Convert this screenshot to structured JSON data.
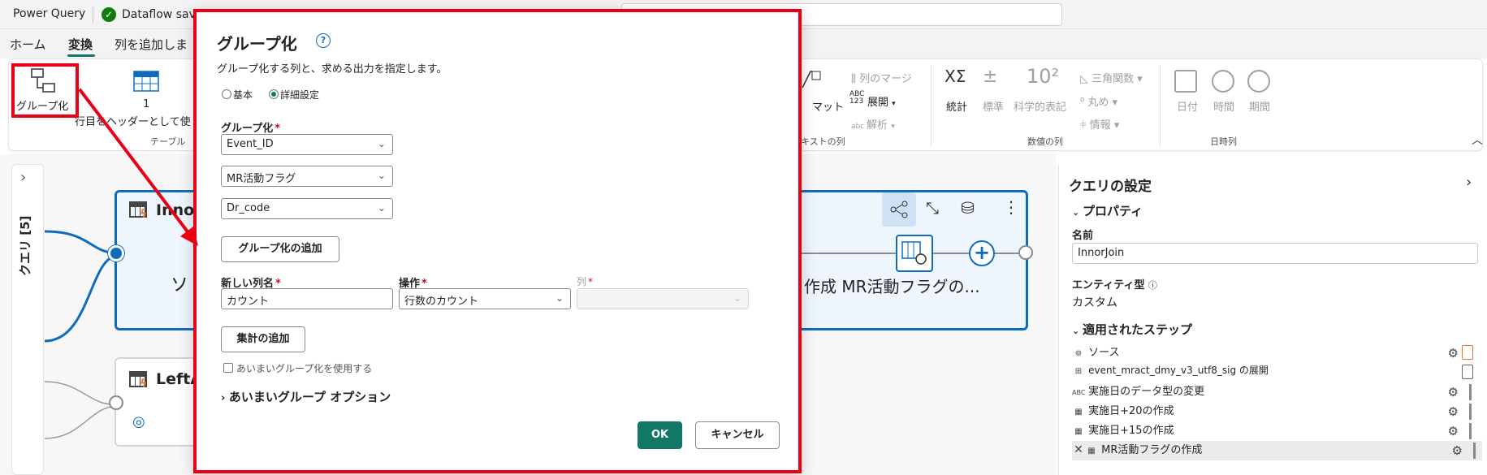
{
  "app": {
    "title": "Power Query",
    "saved_status": "Dataflow save"
  },
  "tabs": [
    {
      "label": "ホーム",
      "active": false
    },
    {
      "label": "変換",
      "active": true
    },
    {
      "label": "列を追加しま",
      "active": false
    }
  ],
  "ribbon": {
    "groupby_label": "グループ化",
    "header_line1": "1",
    "header_line2": "行目をヘッダーとして使",
    "group_table": "テーブル",
    "format_frag": "マット",
    "merge_cols": "列のマージ",
    "expand": "展開",
    "parse": "解析",
    "group_text": "キストの列",
    "stats": "統計",
    "standard": "標準",
    "scientific": "科学的表記",
    "trig": "三角関数",
    "rounding": "丸め",
    "info": "情報",
    "group_number": "数値の列",
    "date": "日付",
    "time": "時間",
    "duration": "期間",
    "group_datetime": "日時列",
    "stats_symbol": "XΣ",
    "power_symbol": "10²",
    "abc_badge": "ABC 123"
  },
  "side_panel": {
    "label": "クエリ [5]"
  },
  "canvas": {
    "card1_title": "Inno",
    "card1_text": "ソ",
    "card1_steps_text": "作成  MR活動フラグの...",
    "card2_title": "LeftA"
  },
  "dialog": {
    "title": "グループ化",
    "description": "グループ化する列と、求める出力を指定します。",
    "radio_basic": "基本",
    "radio_advanced": "詳細設定",
    "groupby_label": "グループ化",
    "groupby_fields": [
      "Event_ID",
      "MR活動フラグ",
      "Dr_code"
    ],
    "add_grouping_button": "グループ化の追加",
    "new_col_label": "新しい列名",
    "operation_label": "操作",
    "column_label": "列",
    "new_col_value": "カウント",
    "operation_value": "行数のカウント",
    "column_value": "",
    "add_aggregation_button": "集計の追加",
    "fuzzy_checkbox": "あいまいグループ化を使用する",
    "fuzzy_options": "あいまいグループ オプション",
    "ok": "OK",
    "cancel": "キャンセル"
  },
  "query_settings": {
    "title": "クエリの設定",
    "properties": "プロパティ",
    "name_label": "名前",
    "name_value": "InnorJoin",
    "entity_label": "エンティティ型",
    "entity_value": "カスタム",
    "applied_steps": "適用されたステップ",
    "steps": [
      "ソース",
      "event_mract_dmy_v3_utf8_sig の展開",
      "実施日のデータ型の変更",
      "実施日+20の作成",
      "実施日+15の作成",
      "MR活動フラグの作成"
    ]
  },
  "colors": {
    "accent": "#117865",
    "highlight_red": "#ea0014",
    "node_blue": "#0f6cbd"
  }
}
